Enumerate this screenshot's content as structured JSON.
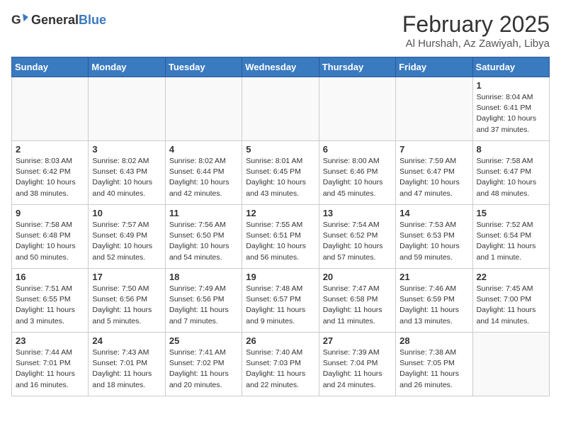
{
  "header": {
    "logo_general": "General",
    "logo_blue": "Blue",
    "month": "February 2025",
    "location": "Al Hurshah, Az Zawiyah, Libya"
  },
  "weekdays": [
    "Sunday",
    "Monday",
    "Tuesday",
    "Wednesday",
    "Thursday",
    "Friday",
    "Saturday"
  ],
  "weeks": [
    [
      {
        "day": "",
        "info": ""
      },
      {
        "day": "",
        "info": ""
      },
      {
        "day": "",
        "info": ""
      },
      {
        "day": "",
        "info": ""
      },
      {
        "day": "",
        "info": ""
      },
      {
        "day": "",
        "info": ""
      },
      {
        "day": "1",
        "info": "Sunrise: 8:04 AM\nSunset: 6:41 PM\nDaylight: 10 hours and 37 minutes."
      }
    ],
    [
      {
        "day": "2",
        "info": "Sunrise: 8:03 AM\nSunset: 6:42 PM\nDaylight: 10 hours and 38 minutes."
      },
      {
        "day": "3",
        "info": "Sunrise: 8:02 AM\nSunset: 6:43 PM\nDaylight: 10 hours and 40 minutes."
      },
      {
        "day": "4",
        "info": "Sunrise: 8:02 AM\nSunset: 6:44 PM\nDaylight: 10 hours and 42 minutes."
      },
      {
        "day": "5",
        "info": "Sunrise: 8:01 AM\nSunset: 6:45 PM\nDaylight: 10 hours and 43 minutes."
      },
      {
        "day": "6",
        "info": "Sunrise: 8:00 AM\nSunset: 6:46 PM\nDaylight: 10 hours and 45 minutes."
      },
      {
        "day": "7",
        "info": "Sunrise: 7:59 AM\nSunset: 6:47 PM\nDaylight: 10 hours and 47 minutes."
      },
      {
        "day": "8",
        "info": "Sunrise: 7:58 AM\nSunset: 6:47 PM\nDaylight: 10 hours and 48 minutes."
      }
    ],
    [
      {
        "day": "9",
        "info": "Sunrise: 7:58 AM\nSunset: 6:48 PM\nDaylight: 10 hours and 50 minutes."
      },
      {
        "day": "10",
        "info": "Sunrise: 7:57 AM\nSunset: 6:49 PM\nDaylight: 10 hours and 52 minutes."
      },
      {
        "day": "11",
        "info": "Sunrise: 7:56 AM\nSunset: 6:50 PM\nDaylight: 10 hours and 54 minutes."
      },
      {
        "day": "12",
        "info": "Sunrise: 7:55 AM\nSunset: 6:51 PM\nDaylight: 10 hours and 56 minutes."
      },
      {
        "day": "13",
        "info": "Sunrise: 7:54 AM\nSunset: 6:52 PM\nDaylight: 10 hours and 57 minutes."
      },
      {
        "day": "14",
        "info": "Sunrise: 7:53 AM\nSunset: 6:53 PM\nDaylight: 10 hours and 59 minutes."
      },
      {
        "day": "15",
        "info": "Sunrise: 7:52 AM\nSunset: 6:54 PM\nDaylight: 11 hours and 1 minute."
      }
    ],
    [
      {
        "day": "16",
        "info": "Sunrise: 7:51 AM\nSunset: 6:55 PM\nDaylight: 11 hours and 3 minutes."
      },
      {
        "day": "17",
        "info": "Sunrise: 7:50 AM\nSunset: 6:56 PM\nDaylight: 11 hours and 5 minutes."
      },
      {
        "day": "18",
        "info": "Sunrise: 7:49 AM\nSunset: 6:56 PM\nDaylight: 11 hours and 7 minutes."
      },
      {
        "day": "19",
        "info": "Sunrise: 7:48 AM\nSunset: 6:57 PM\nDaylight: 11 hours and 9 minutes."
      },
      {
        "day": "20",
        "info": "Sunrise: 7:47 AM\nSunset: 6:58 PM\nDaylight: 11 hours and 11 minutes."
      },
      {
        "day": "21",
        "info": "Sunrise: 7:46 AM\nSunset: 6:59 PM\nDaylight: 11 hours and 13 minutes."
      },
      {
        "day": "22",
        "info": "Sunrise: 7:45 AM\nSunset: 7:00 PM\nDaylight: 11 hours and 14 minutes."
      }
    ],
    [
      {
        "day": "23",
        "info": "Sunrise: 7:44 AM\nSunset: 7:01 PM\nDaylight: 11 hours and 16 minutes."
      },
      {
        "day": "24",
        "info": "Sunrise: 7:43 AM\nSunset: 7:01 PM\nDaylight: 11 hours and 18 minutes."
      },
      {
        "day": "25",
        "info": "Sunrise: 7:41 AM\nSunset: 7:02 PM\nDaylight: 11 hours and 20 minutes."
      },
      {
        "day": "26",
        "info": "Sunrise: 7:40 AM\nSunset: 7:03 PM\nDaylight: 11 hours and 22 minutes."
      },
      {
        "day": "27",
        "info": "Sunrise: 7:39 AM\nSunset: 7:04 PM\nDaylight: 11 hours and 24 minutes."
      },
      {
        "day": "28",
        "info": "Sunrise: 7:38 AM\nSunset: 7:05 PM\nDaylight: 11 hours and 26 minutes."
      },
      {
        "day": "",
        "info": ""
      }
    ]
  ]
}
